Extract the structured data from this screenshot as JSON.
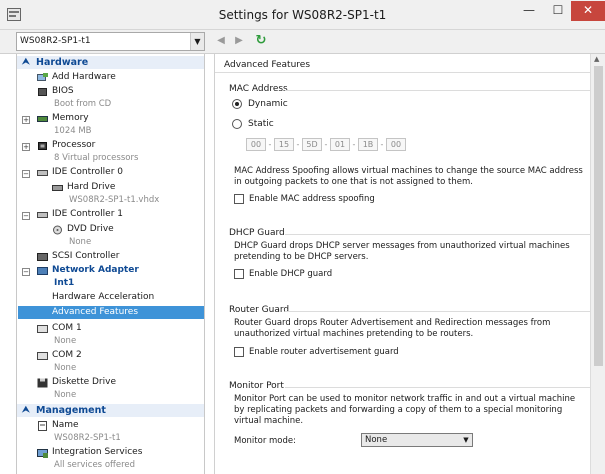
{
  "window": {
    "title": "Settings for WS08R2-SP1-t1",
    "min_symbol": "—",
    "max_symbol": "☐",
    "close_symbol": "✕"
  },
  "toolbar": {
    "vm_selected": "WS08R2-SP1-t1",
    "back_symbol": "◀",
    "forward_symbol": "▶",
    "refresh_symbol": "↻"
  },
  "sidebar": {
    "hardware_header": "Hardware",
    "add_hardware": "Add Hardware",
    "bios": "BIOS",
    "bios_sub": "Boot from CD",
    "memory": "Memory",
    "memory_sub": "1024 MB",
    "processor": "Processor",
    "processor_sub": "8 Virtual processors",
    "ide0": "IDE Controller 0",
    "hard_drive": "Hard Drive",
    "hard_drive_sub": "WS08R2-SP1-t1.vhdx",
    "ide1": "IDE Controller 1",
    "dvd_drive": "DVD Drive",
    "dvd_sub": "None",
    "scsi": "SCSI Controller",
    "network_adapter": "Network Adapter",
    "int1": "Int1",
    "hw_accel": "Hardware Acceleration",
    "adv_features": "Advanced Features",
    "com1": "COM 1",
    "com1_sub": "None",
    "com2": "COM 2",
    "com2_sub": "None",
    "diskette": "Diskette Drive",
    "diskette_sub": "None",
    "management_header": "Management",
    "name": "Name",
    "name_sub": "WS08R2-SP1-t1",
    "integration": "Integration Services",
    "integration_sub": "All services offered"
  },
  "main": {
    "title": "Advanced Features",
    "mac_group": "MAC Address",
    "dynamic": "Dynamic",
    "static": "Static",
    "mac_octets": [
      "00",
      "15",
      "5D",
      "01",
      "1B",
      "00"
    ],
    "mac_spoof_desc": "MAC Address Spoofing allows virtual machines to change the source MAC address in outgoing packets to one that is not assigned to them.",
    "mac_spoof_label": "Enable MAC address spoofing",
    "dhcp_group": "DHCP Guard",
    "dhcp_desc": "DHCP Guard drops DHCP server messages from unauthorized virtual machines pretending to be DHCP servers.",
    "dhcp_label": "Enable DHCP guard",
    "router_group": "Router Guard",
    "router_desc": "Router Guard drops Router Advertisement and Redirection messages from unauthorized virtual machines pretending to be routers.",
    "router_label": "Enable router advertisement guard",
    "monitor_group": "Monitor Port",
    "monitor_desc": "Monitor Port can be used to monitor network traffic in and out a virtual machine by replicating packets and forwarding a copy of them to a special monitoring virtual machine.",
    "monitor_mode_label": "Monitor mode:",
    "monitor_mode_value": "None"
  },
  "colors": {
    "accent": "#0f4a94",
    "selection": "#3e93d8",
    "close_button": "#c7463d"
  }
}
